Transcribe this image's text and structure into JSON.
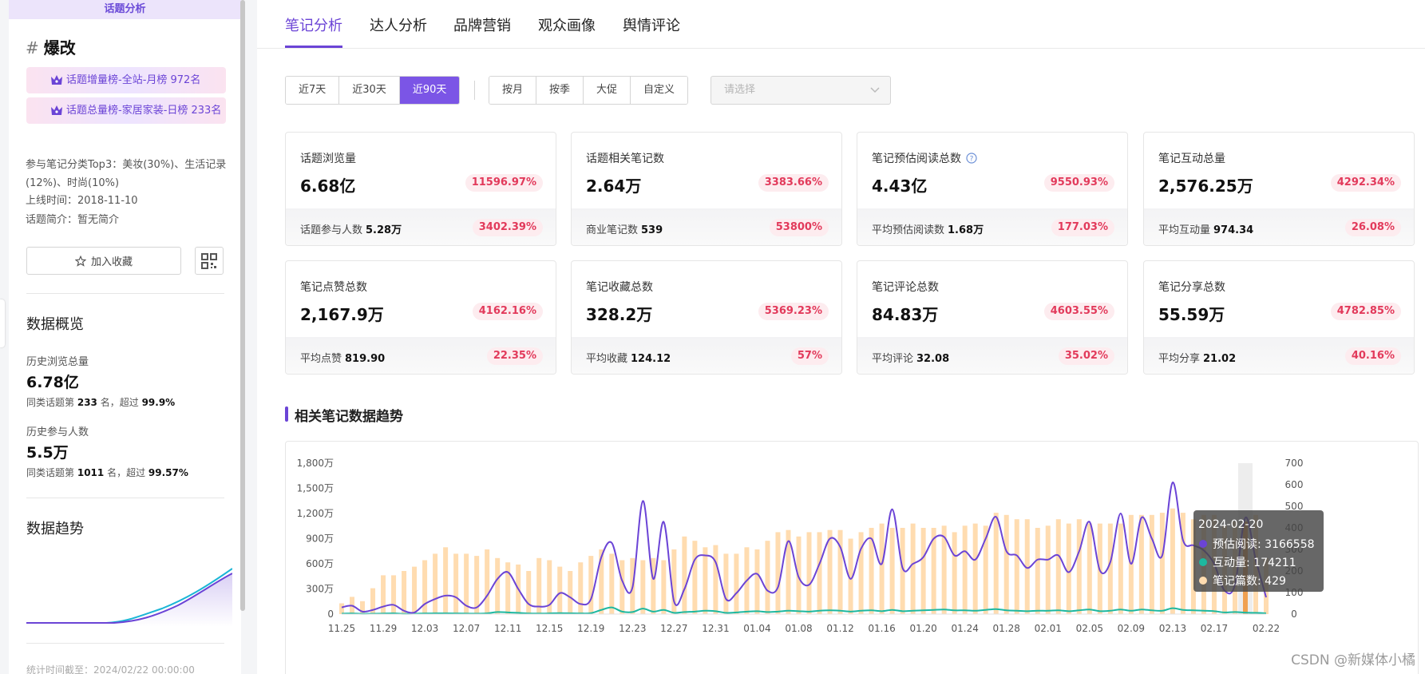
{
  "sidebar": {
    "header": "话题分析",
    "topic_hash": "#",
    "topic_name": "爆改",
    "badges": [
      "话题增量榜-全站-月榜 972名",
      "话题总量榜-家居家装-日榜 233名"
    ],
    "meta": {
      "categories": "参与笔记分类Top3：美妆(30%)、生活记录(12%)、时尚(10%)",
      "launch": "上线时间：2018-11-10",
      "intro": "话题简介：暂无简介"
    },
    "collect_label": "加入收藏",
    "overview_title": "数据概览",
    "history_views_label": "历史浏览总量",
    "history_views_value": "6.78亿",
    "history_views_rank_pre": "同类话题第",
    "history_views_rank": "233",
    "history_views_rank_mid": "名，超过",
    "history_views_pct": "99.9%",
    "history_people_label": "历史参与人数",
    "history_people_value": "5.5万",
    "history_people_rank_pre": "同类话题第",
    "history_people_rank": "1011",
    "history_people_rank_mid": "名，超过",
    "history_people_pct": "99.57%",
    "trend_title": "数据趋势",
    "footer": "统计时间截至：2024/02/22 00:00:00"
  },
  "tabs": [
    "笔记分析",
    "达人分析",
    "品牌营销",
    "观众画像",
    "舆情评论"
  ],
  "active_tab": 0,
  "ranges": [
    "近7天",
    "近30天",
    "近90天"
  ],
  "active_range": 2,
  "periods": [
    "按月",
    "按季",
    "大促",
    "自定义"
  ],
  "select_placeholder": "请选择",
  "metrics": [
    {
      "label": "话题浏览量",
      "value": "6.68亿",
      "pct": "11596.97%",
      "foot_label": "话题参与人数",
      "foot_value": "5.28万",
      "foot_pct": "3402.39%",
      "help": false
    },
    {
      "label": "话题相关笔记数",
      "value": "2.64万",
      "pct": "3383.66%",
      "foot_label": "商业笔记数",
      "foot_value": "539",
      "foot_pct": "53800%",
      "help": false
    },
    {
      "label": "笔记预估阅读总数",
      "value": "4.43亿",
      "pct": "9550.93%",
      "foot_label": "平均预估阅读数",
      "foot_value": "1.68万",
      "foot_pct": "177.03%",
      "help": true
    },
    {
      "label": "笔记互动总量",
      "value": "2,576.25万",
      "pct": "4292.34%",
      "foot_label": "平均互动量",
      "foot_value": "974.34",
      "foot_pct": "26.08%",
      "help": false
    },
    {
      "label": "笔记点赞总数",
      "value": "2,167.9万",
      "pct": "4162.16%",
      "foot_label": "平均点赞",
      "foot_value": "819.90",
      "foot_pct": "22.35%",
      "help": false
    },
    {
      "label": "笔记收藏总数",
      "value": "328.2万",
      "pct": "5369.23%",
      "foot_label": "平均收藏",
      "foot_value": "124.12",
      "foot_pct": "57%",
      "help": false
    },
    {
      "label": "笔记评论总数",
      "value": "84.83万",
      "pct": "4603.55%",
      "foot_label": "平均评论",
      "foot_value": "32.08",
      "foot_pct": "35.02%",
      "help": false
    },
    {
      "label": "笔记分享总数",
      "value": "55.59万",
      "pct": "4782.85%",
      "foot_label": "平均分享",
      "foot_value": "21.02",
      "foot_pct": "40.16%",
      "help": false
    }
  ],
  "section_title": "相关笔记数据趋势",
  "tooltip": {
    "date": "2024-02-20",
    "rows": [
      {
        "name": "预估阅读",
        "value": "3166558",
        "color": "#6b44d6"
      },
      {
        "name": "互动量",
        "value": "174211",
        "color": "#1db8a0"
      },
      {
        "name": "笔记篇数",
        "value": "429",
        "color": "#ffdcb0"
      }
    ]
  },
  "watermark": "CSDN @新媒体小橘",
  "chart_data": {
    "type": "line",
    "x": [
      "11.25",
      "11.26",
      "11.27",
      "11.28",
      "11.29",
      "11.30",
      "12.01",
      "12.02",
      "12.03",
      "12.04",
      "12.05",
      "12.06",
      "12.07",
      "12.08",
      "12.09",
      "12.10",
      "12.11",
      "12.12",
      "12.13",
      "12.14",
      "12.15",
      "12.16",
      "12.17",
      "12.18",
      "12.19",
      "12.20",
      "12.21",
      "12.22",
      "12.23",
      "12.24",
      "12.25",
      "12.26",
      "12.27",
      "12.28",
      "12.29",
      "12.30",
      "12.31",
      "01.01",
      "01.02",
      "01.03",
      "01.04",
      "01.05",
      "01.06",
      "01.07",
      "01.08",
      "01.09",
      "01.10",
      "01.11",
      "01.12",
      "01.13",
      "01.14",
      "01.15",
      "01.16",
      "01.17",
      "01.18",
      "01.19",
      "01.20",
      "01.21",
      "01.22",
      "01.23",
      "01.24",
      "01.25",
      "01.26",
      "01.27",
      "01.28",
      "01.29",
      "01.30",
      "01.31",
      "02.01",
      "02.02",
      "02.03",
      "02.04",
      "02.05",
      "02.06",
      "02.07",
      "02.08",
      "02.09",
      "02.10",
      "02.11",
      "02.12",
      "02.13",
      "02.14",
      "02.15",
      "02.16",
      "02.17",
      "02.18",
      "02.19",
      "02.20",
      "02.21",
      "02.22"
    ],
    "x_tick_labels": [
      "11.25",
      "11.29",
      "12.03",
      "12.07",
      "12.11",
      "12.15",
      "12.19",
      "12.23",
      "12.27",
      "12.31",
      "01.04",
      "01.08",
      "01.12",
      "01.16",
      "01.20",
      "01.24",
      "01.28",
      "02.01",
      "02.05",
      "02.09",
      "02.13",
      "02.17",
      "02.22"
    ],
    "y_left_ticks": [
      "0",
      "300万",
      "600万",
      "900万",
      "1,200万",
      "1,500万",
      "1,800万"
    ],
    "y_left_range": [
      0,
      18000000
    ],
    "y_right_ticks": [
      "0",
      "100",
      "200",
      "300",
      "400",
      "500",
      "600",
      "700"
    ],
    "y_right_range": [
      0,
      700
    ],
    "series": [
      {
        "name": "预估阅读",
        "axis": "left",
        "color": "#6b44d6",
        "values": [
          800000,
          1000000,
          300000,
          500000,
          900000,
          1100000,
          400000,
          200000,
          1200000,
          1800000,
          2200000,
          2000000,
          1000000,
          800000,
          2200000,
          4200000,
          5000000,
          3000000,
          1200000,
          900000,
          1100000,
          2500000,
          2000000,
          1200000,
          1800000,
          6800000,
          8500000,
          4000000,
          3200000,
          13500000,
          4200000,
          11000000,
          1500000,
          3000000,
          6500000,
          7000000,
          6200000,
          1800000,
          2500000,
          4000000,
          4800000,
          2800000,
          3200000,
          8700000,
          4400000,
          3500000,
          6000000,
          9000000,
          8000000,
          4200000,
          7800000,
          9000000,
          6000000,
          12500000,
          5500000,
          6000000,
          6800000,
          9000000,
          9200000,
          7000000,
          7500000,
          6500000,
          9000000,
          11600000,
          7500000,
          7000000,
          5500000,
          6500000,
          6500000,
          7000000,
          5000000,
          7500000,
          11000000,
          5200000,
          6200000,
          12000000,
          6000000,
          11500000,
          9000000,
          7000000,
          15700000,
          8800000,
          8200000,
          7600000,
          6000000,
          2800000,
          3500000,
          11500000,
          6500000,
          2000000
        ]
      },
      {
        "name": "互动量",
        "axis": "left",
        "color": "#1db8a0",
        "values": [
          60000,
          80000,
          40000,
          50000,
          70000,
          90000,
          40000,
          50000,
          80000,
          100000,
          90000,
          80000,
          70000,
          60000,
          100000,
          250000,
          200000,
          150000,
          80000,
          70000,
          90000,
          120000,
          100000,
          80000,
          120000,
          500000,
          800000,
          300000,
          250000,
          650000,
          300000,
          500000,
          150000,
          250000,
          300000,
          400000,
          350000,
          150000,
          200000,
          300000,
          350000,
          250000,
          300000,
          400000,
          350000,
          300000,
          400000,
          450000,
          400000,
          300000,
          400000,
          450000,
          350000,
          500000,
          350000,
          400000,
          450000,
          500000,
          550000,
          450000,
          450000,
          400000,
          500000,
          600000,
          450000,
          400000,
          350000,
          400000,
          400000,
          450000,
          350000,
          450000,
          550000,
          350000,
          400000,
          550000,
          400000,
          550000,
          450000,
          400000,
          700000,
          500000,
          450000,
          400000,
          350000,
          200000,
          250000,
          174211,
          150000,
          100000
        ]
      },
      {
        "name": "笔记篇数",
        "axis": "right",
        "color": "#ffdcb0",
        "values": [
          50,
          80,
          60,
          120,
          180,
          180,
          200,
          220,
          250,
          280,
          310,
          280,
          280,
          270,
          300,
          260,
          240,
          230,
          200,
          260,
          250,
          220,
          200,
          240,
          270,
          300,
          280,
          250,
          260,
          250,
          260,
          250,
          300,
          360,
          340,
          310,
          320,
          280,
          280,
          310,
          300,
          340,
          380,
          390,
          360,
          380,
          380,
          390,
          390,
          350,
          380,
          400,
          420,
          400,
          400,
          420,
          400,
          400,
          410,
          380,
          410,
          420,
          410,
          470,
          460,
          440,
          440,
          400,
          410,
          440,
          420,
          440,
          420,
          420,
          420,
          420,
          460,
          460,
          460,
          470,
          490,
          470,
          440,
          460,
          460,
          410,
          430,
          429,
          460,
          260
        ]
      }
    ]
  }
}
